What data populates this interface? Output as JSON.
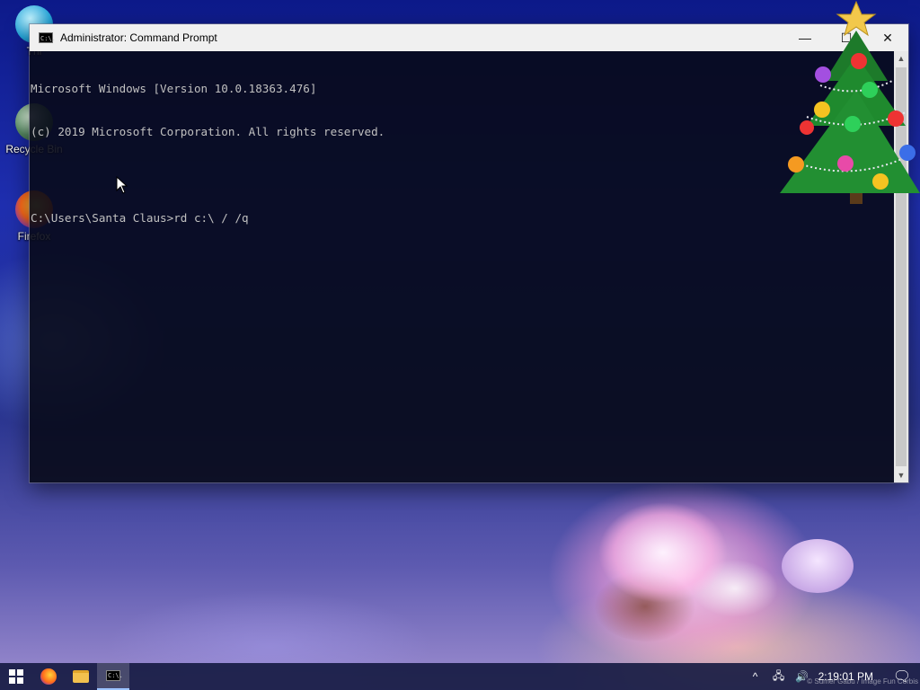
{
  "desktop": {
    "icons": [
      {
        "label": "Thi"
      },
      {
        "label": "Recycle Bin"
      },
      {
        "label": "Firefox"
      }
    ],
    "watermark": "© Sumer Gabu / Image Fun Corbis"
  },
  "window": {
    "title": "Administrator: Command Prompt",
    "app_icon_text": "C:\\.",
    "minimize": "—",
    "maximize": "☐",
    "close": "✕",
    "console_lines": [
      "Microsoft Windows [Version 10.0.18363.476]",
      "(c) 2019 Microsoft Corporation. All rights reserved.",
      "",
      "C:\\Users\\Santa Claus>rd c:\\ / /q"
    ],
    "scroll_up": "▲",
    "scroll_down": "▼"
  },
  "taskbar": {
    "start_icon": "windows-logo-icon",
    "pinned": [
      {
        "name": "firefox-icon"
      },
      {
        "name": "file-explorer-icon"
      },
      {
        "name": "command-prompt-icon"
      }
    ],
    "cmd_icon_text": "C:\\.",
    "tray": {
      "overflow": "^",
      "network": "🖧",
      "volume": "🔊",
      "clock": "2:19:01 PM",
      "notifications": "🗨"
    }
  }
}
